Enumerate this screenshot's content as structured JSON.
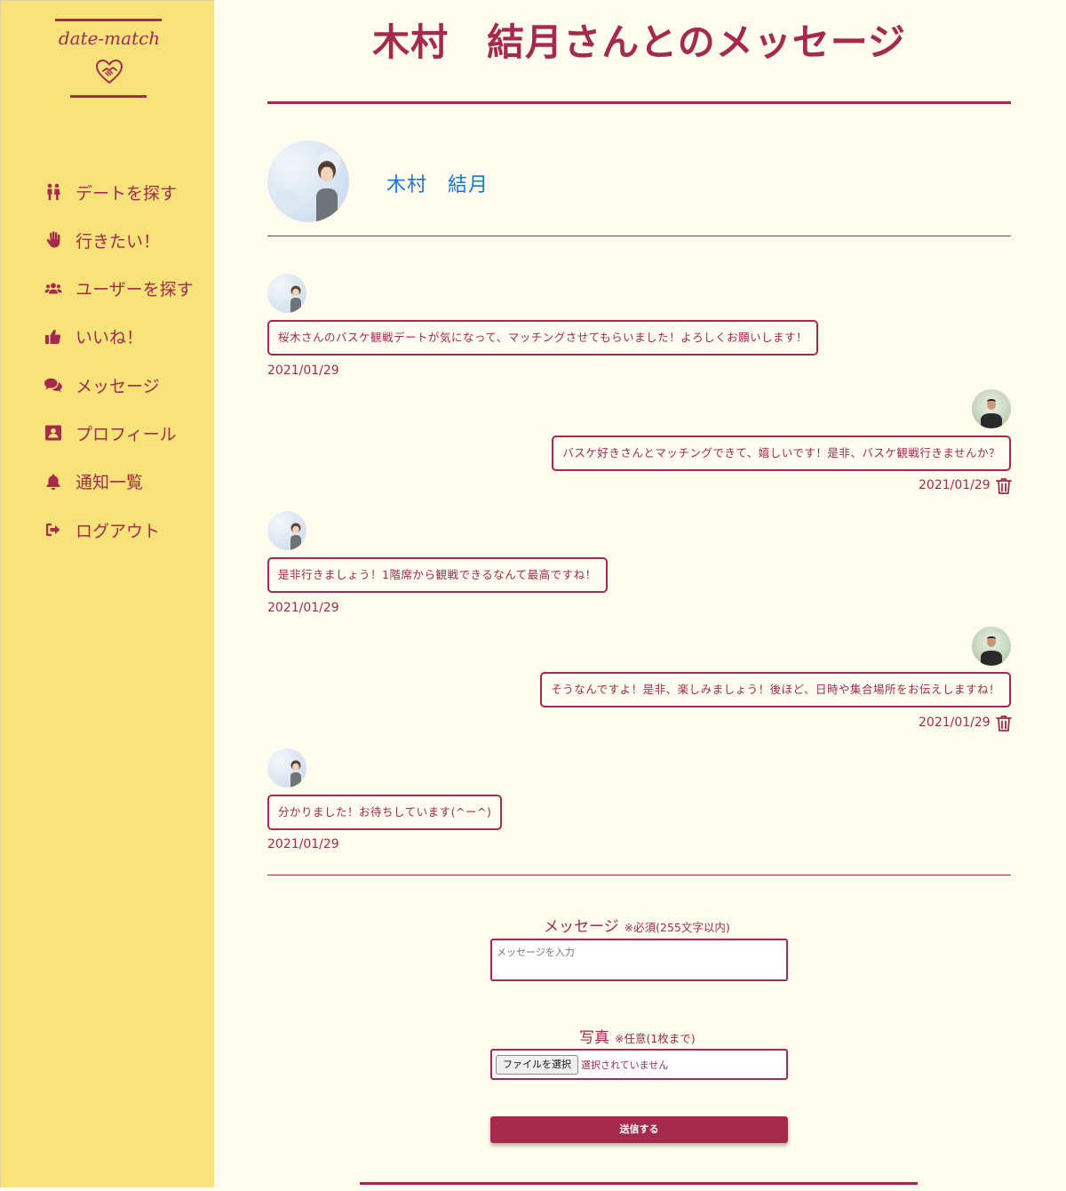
{
  "app": {
    "logo_text": "date-match"
  },
  "colors": {
    "accent": "#a52a4e",
    "sidebar": "#f8e27a",
    "background": "#fffdee",
    "link": "#1a73e8"
  },
  "sidebar": {
    "items": [
      {
        "label": "デートを探す",
        "icon": "couple-icon"
      },
      {
        "label": "行きたい！",
        "icon": "hand-icon"
      },
      {
        "label": "ユーザーを探す",
        "icon": "users-icon"
      },
      {
        "label": "いいね！",
        "icon": "thumbs-up-icon"
      },
      {
        "label": "メッセージ",
        "icon": "comments-icon"
      },
      {
        "label": "プロフィール",
        "icon": "profile-icon"
      },
      {
        "label": "通知一覧",
        "icon": "bell-icon"
      },
      {
        "label": "ログアウト",
        "icon": "logout-icon"
      }
    ]
  },
  "page": {
    "title": "木村　結月さんとのメッセージ"
  },
  "partner": {
    "name": "木村　結月"
  },
  "messages": [
    {
      "from": "partner",
      "text": "桜木さんのバスケ観戦デートが気になって、マッチングさせてもらいました！よろしくお願いします！",
      "date": "2021/01/29"
    },
    {
      "from": "me",
      "text": "バスケ好きさんとマッチングできて、嬉しいです！是非、バスケ観戦行きませんか？",
      "date": "2021/01/29"
    },
    {
      "from": "partner",
      "text": "是非行きましょう！1階席から観戦できるなんて最高ですね！",
      "date": "2021/01/29"
    },
    {
      "from": "me",
      "text": "そうなんですよ！是非、楽しみましょう！後ほど、日時や集合場所をお伝えしますね！",
      "date": "2021/01/29"
    },
    {
      "from": "partner",
      "text": "分かりました！お待ちしています(^ー^)",
      "date": "2021/01/29"
    }
  ],
  "form": {
    "message_label": "メッセージ",
    "message_note": "※必須(255文字以内)",
    "message_placeholder": "メッセージを入力",
    "photo_label": "写真",
    "photo_note": "※任意(1枚まで)",
    "file_button": "ファイルを選択",
    "file_status": "選択されていません",
    "submit": "送信する"
  }
}
